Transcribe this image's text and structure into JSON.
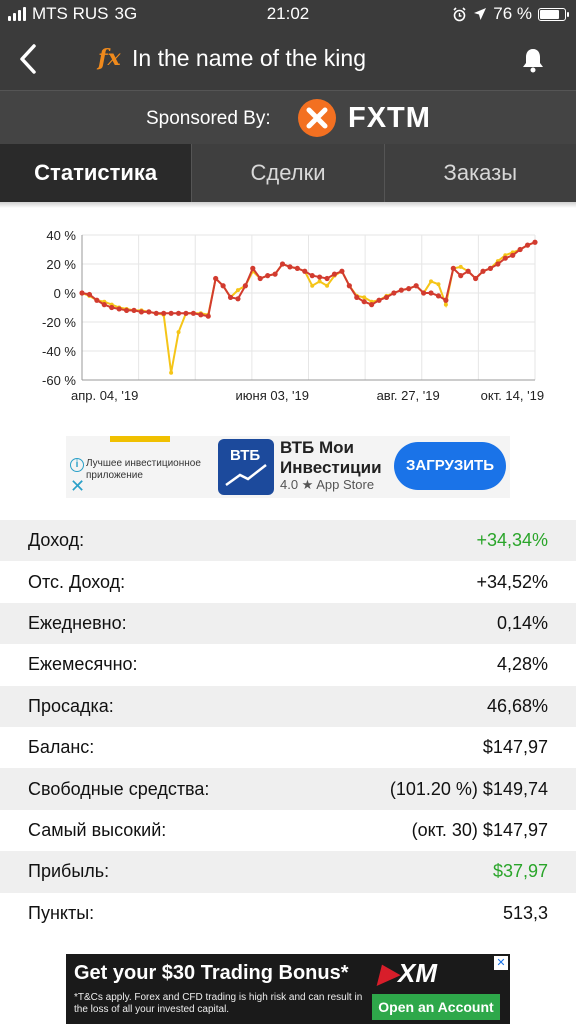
{
  "status_bar": {
    "carrier": "MTS RUS",
    "network": "3G",
    "time": "21:02",
    "battery": "76 %"
  },
  "nav": {
    "fx_logo": "fx",
    "title": "In the name of the king"
  },
  "sponsor": {
    "label": "Sponsored By:",
    "brand": "FXTM"
  },
  "tabs": [
    {
      "label": "Статистика",
      "active": true
    },
    {
      "label": "Сделки",
      "active": false
    },
    {
      "label": "Заказы",
      "active": false
    }
  ],
  "chart_data": {
    "type": "line",
    "x_tick_labels": [
      "апр. 04, '19",
      "июня 03, '19",
      "авг. 27, '19",
      "окт. 14, '19"
    ],
    "y_tick_labels": [
      "40 %",
      "20 %",
      "0 %",
      "-20 %",
      "-40 %",
      "-60 %"
    ],
    "ylim": [
      -60,
      40
    ],
    "grid": true,
    "series": [
      {
        "color": "#f5c518",
        "values": [
          0,
          -2,
          -5,
          -6,
          -8,
          -10,
          -11,
          -12,
          -12,
          -13,
          -14,
          -15,
          -55,
          -27,
          -14,
          -14,
          -14,
          -15,
          10,
          5,
          -3,
          2,
          5,
          15,
          10,
          12,
          13,
          20,
          18,
          17,
          15,
          5,
          8,
          5,
          12,
          15,
          5,
          -2,
          -3,
          -6,
          -5,
          -2,
          0,
          2,
          3,
          5,
          0,
          8,
          6,
          -8,
          17,
          18,
          15,
          10,
          15,
          17,
          22,
          26,
          28,
          30,
          33,
          35
        ]
      },
      {
        "color": "#d23b2f",
        "values": [
          0,
          -1,
          -5,
          -8,
          -10,
          -11,
          -12,
          -12,
          -13,
          -13,
          -14,
          -14,
          -14,
          -14,
          -14,
          -14,
          -15,
          -16,
          10,
          5,
          -3,
          -4,
          5,
          17,
          10,
          12,
          13,
          20,
          18,
          17,
          15,
          12,
          11,
          10,
          13,
          15,
          5,
          -3,
          -6,
          -8,
          -5,
          -3,
          0,
          2,
          3,
          5,
          0,
          0,
          -2,
          -5,
          17,
          12,
          15,
          10,
          15,
          17,
          20,
          24,
          26,
          30,
          33,
          35
        ]
      }
    ]
  },
  "ad_top": {
    "info_text": "Лучшее инвестиционное приложение",
    "app_icon_text": "ВТБ",
    "app_name": "ВТБ Мои Инвестиции",
    "rating": "4.0 ★ App Store",
    "cta": "ЗАГРУЗИТЬ"
  },
  "stats": [
    {
      "label": "Доход:",
      "value": "+34,34%",
      "green": true
    },
    {
      "label": "Отс. Доход:",
      "value": "+34,52%",
      "green": false
    },
    {
      "label": "Ежедневно:",
      "value": "0,14%",
      "green": false
    },
    {
      "label": "Ежемесячно:",
      "value": "4,28%",
      "green": false
    },
    {
      "label": "Просадка:",
      "value": "46,68%",
      "green": false
    },
    {
      "label": "Баланс:",
      "value": "$147,97",
      "green": false
    },
    {
      "label": "Свободные средства:",
      "value": "(101.20 %) $149,74",
      "green": false
    },
    {
      "label": "Самый высокий:",
      "value": "(окт. 30) $147,97",
      "green": false
    },
    {
      "label": "Прибыль:",
      "value": "$37,97",
      "green": true
    },
    {
      "label": "Пункты:",
      "value": "513,3",
      "green": false
    }
  ],
  "ad_bottom": {
    "headline": "Get your $30 Trading Bonus*",
    "fine_print": "*T&Cs apply. Forex and CFD trading is high risk and can result in the loss of all your invested capital.",
    "brand": "XM",
    "cta": "Open an Account",
    "brand_color": "#d81e2a"
  }
}
